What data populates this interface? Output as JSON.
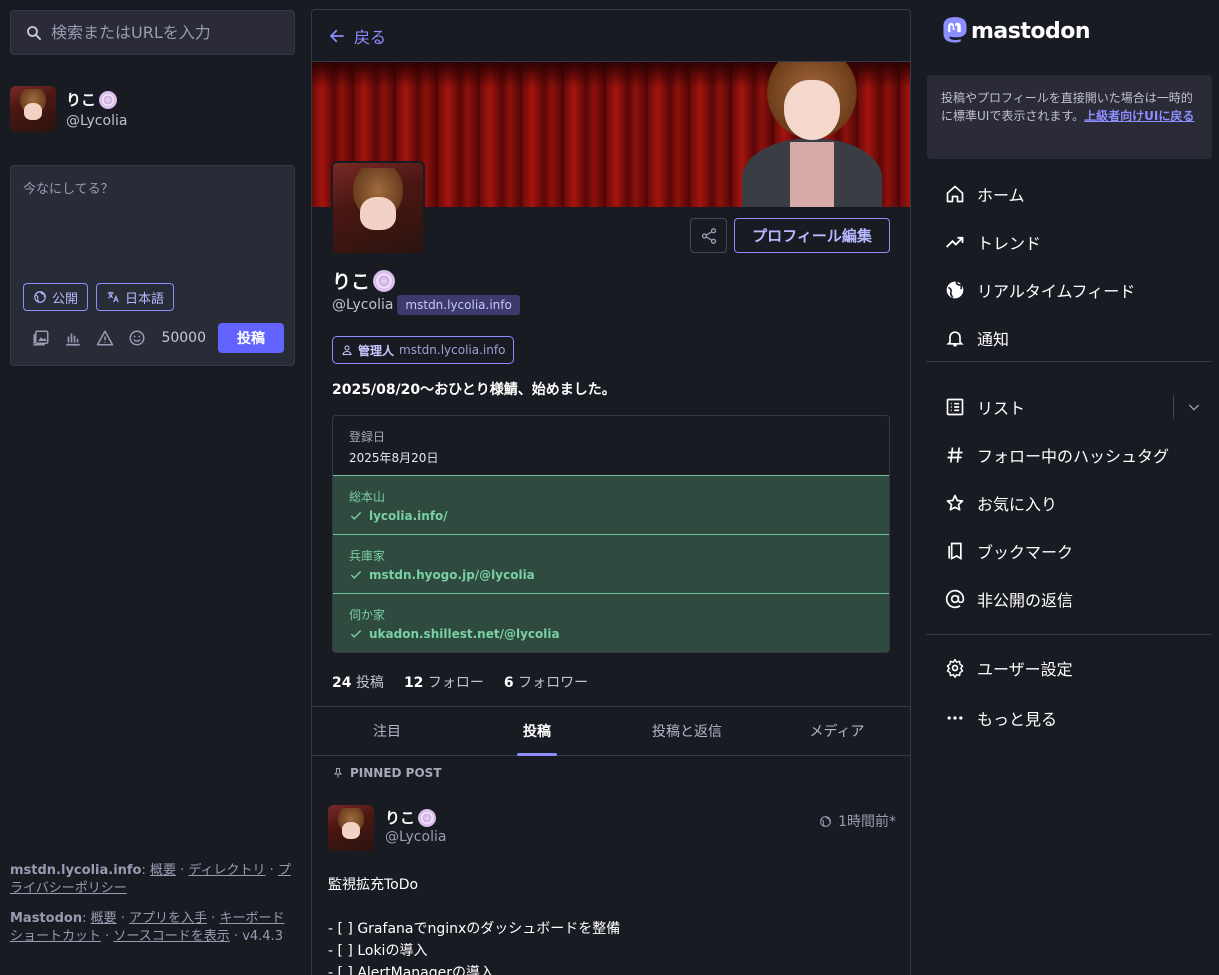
{
  "search": {
    "placeholder": "検索またはURLを入力"
  },
  "me": {
    "name": "りこ",
    "acct": "@Lycolia"
  },
  "compose": {
    "placeholder": "今なにしてる？",
    "visibility": "公開",
    "language": "日本語",
    "char_count": "50000",
    "post_label": "投稿"
  },
  "footer": {
    "instance": "mstdn.lycolia.info",
    "links1": [
      "概要",
      "ディレクトリ",
      "プライバシーポリシー"
    ],
    "brand": "Mastodon",
    "links2": [
      "概要",
      "アプリを入手",
      "キーボードショートカット",
      "ソースコードを表示"
    ],
    "version": "v4.4.3"
  },
  "header": {
    "back_label": "戻る"
  },
  "profile": {
    "name": "りこ",
    "acct": "@Lycolia",
    "domain": "mstdn.lycolia.info",
    "edit_label": "プロフィール編集",
    "role_label": "管理人",
    "role_domain": "mstdn.lycolia.info",
    "bio": "2025/08/20〜おひとり様鯖、始めました。",
    "fields": [
      {
        "key": "登録日",
        "value": "2025年8月20日",
        "verified": false
      },
      {
        "key": "総本山",
        "value": "lycolia.info/",
        "verified": true
      },
      {
        "key": "兵庫家",
        "value": "mstdn.hyogo.jp/@lycolia",
        "verified": true
      },
      {
        "key": "伺か家",
        "value": "ukadon.shillest.net/@lycolia",
        "verified": true
      }
    ],
    "stats": {
      "posts_count": "24",
      "posts_label": "投稿",
      "following_count": "12",
      "following_label": "フォロー",
      "followers_count": "6",
      "followers_label": "フォロワー"
    },
    "tabs": [
      "注目",
      "投稿",
      "投稿と返信",
      "メディア"
    ],
    "active_tab": "投稿"
  },
  "pinned": {
    "label": "PINNED POST",
    "name": "りこ",
    "acct": "@Lycolia",
    "time": "1時間前",
    "edited_mark": "*",
    "body": "監視拡充ToDo\n\n- [ ] Grafanaでnginxのダッシュボードを整備\n- [ ] Lokiの導入\n- [ ] AlertManagerの導入"
  },
  "right": {
    "brand": "mastodon",
    "notice_text": "投稿やプロフィールを直接開いた場合は一時的に標準UIで表示されます。",
    "notice_link": "上級者向けUIに戻る",
    "nav": {
      "home": "ホーム",
      "trends": "トレンド",
      "live": "リアルタイムフィード",
      "notifications": "通知",
      "lists": "リスト",
      "hashtags": "フォロー中のハッシュタグ",
      "favourites": "お気に入り",
      "bookmarks": "ブックマーク",
      "mentions": "非公開の返信",
      "settings": "ユーザー設定",
      "more": "もっと見る"
    }
  },
  "colors": {
    "accent": "#6364ff",
    "accent_light": "#8c8dff",
    "verified": "#79d0a4",
    "bg": "#191b22",
    "panel": "#282c37"
  }
}
